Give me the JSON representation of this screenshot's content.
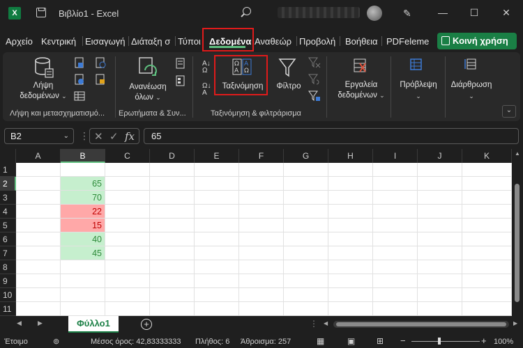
{
  "titlebar": {
    "app_icon_letter": "X",
    "doc_title": "Βιβλίο1 - Excel",
    "minimize": "—",
    "restore": "☐",
    "close": "✕"
  },
  "tabs": {
    "items": [
      "Αρχείο",
      "Κεντρική",
      "Εισαγωγή",
      "Διάταξη σ",
      "Τύποι",
      "Δεδομένα",
      "Αναθεώρ",
      "Προβολή",
      "Βοήθεια",
      "PDFeleme"
    ],
    "active": "Δεδομένα",
    "share_label": "Κοινή χρήση"
  },
  "ribbon": {
    "get_data_label": "Λήψη",
    "get_data_label2": "δεδομένων",
    "refresh_label": "Ανανέωση",
    "refresh_label2": "όλων",
    "sort_label": "Ταξινόμηση",
    "filter_label": "Φίλτρο",
    "data_tools_label": "Εργαλεία",
    "data_tools_label2": "δεδομένων",
    "forecast_label": "Πρόβλεψη",
    "outline_label": "Διάρθρωση",
    "group1": "Λήψη και μετασχηματισμό...",
    "group2": "Ερωτήματα & Συν...",
    "group3": "Ταξινόμηση & φιλτράρισμα",
    "sort_icon_az": "Α Ω",
    "sort_icon_za": "Ω Α"
  },
  "formula_bar": {
    "name_box": "B2",
    "formula": "65",
    "fx": "fx"
  },
  "grid": {
    "columns": [
      "A",
      "B",
      "C",
      "D",
      "E",
      "F",
      "G",
      "H",
      "I",
      "J",
      "K"
    ],
    "rows": [
      "1",
      "2",
      "3",
      "4",
      "5",
      "6",
      "7",
      "8",
      "9",
      "10",
      "11"
    ],
    "b_values": [
      "",
      "65",
      "70",
      "22",
      "15",
      "40",
      "45",
      "",
      "",
      "",
      ""
    ],
    "b_status": [
      "",
      "green",
      "green",
      "red",
      "red",
      "green",
      "green",
      "",
      "",
      "",
      ""
    ],
    "selected_cell": "B2"
  },
  "sheets": {
    "active": "Φύλλο1",
    "add": "+"
  },
  "status": {
    "ready": "Έτοιμο",
    "average": "Μέσος όρος: 42,83333333",
    "count": "Πλήθος: 6",
    "sum": "Άθροισμα: 257",
    "zoom": "100%",
    "zoom_minus": "−",
    "zoom_plus": "+"
  },
  "colors": {
    "excel_green": "#1a7f45",
    "highlight_red": "#e01b1b",
    "good_fill": "#c6efce",
    "bad_fill": "#ffa8a8"
  }
}
